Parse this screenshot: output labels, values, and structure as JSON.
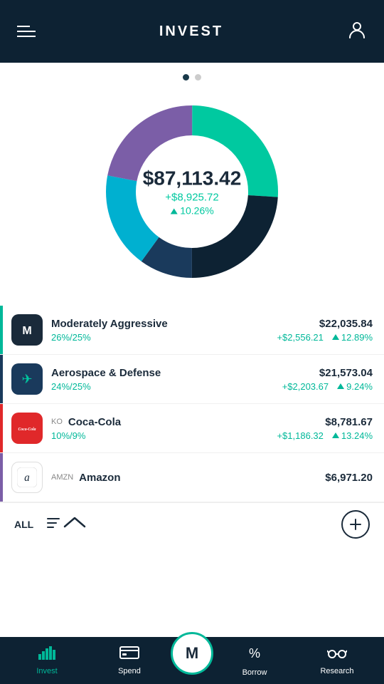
{
  "header": {
    "title": "INVEST",
    "menu_label": "menu",
    "profile_label": "profile"
  },
  "chart": {
    "value": "$87,113.42",
    "gain_dollar": "+$8,925.72",
    "gain_percent": "10.26%",
    "page_dot_active": 0,
    "segments": [
      {
        "color": "#00c9a0",
        "percent": 26,
        "label": "Teal segment"
      },
      {
        "color": "#0d2233",
        "percent": 24,
        "label": "Navy segment"
      },
      {
        "color": "#7b5ea7",
        "percent": 22,
        "label": "Purple segment"
      },
      {
        "color": "#00b0d0",
        "percent": 18,
        "label": "Light blue segment"
      },
      {
        "color": "#1a3a5c",
        "percent": 10,
        "label": "Dark navy segment"
      }
    ]
  },
  "holdings": [
    {
      "id": "moderately-aggressive",
      "name": "Moderately Aggressive",
      "ticker": "",
      "value": "$22,035.84",
      "alloc": "26%/25%",
      "change_dollar": "+$2,556.21",
      "change_pct": "12.89%",
      "color_bar": "teal",
      "icon_type": "m_dark"
    },
    {
      "id": "aerospace-defense",
      "name": "Aerospace & Defense",
      "ticker": "",
      "value": "$21,573.04",
      "alloc": "24%/25%",
      "change_dollar": "+$2,203.67",
      "change_pct": "9.24%",
      "color_bar": "navy",
      "icon_type": "plane"
    },
    {
      "id": "coca-cola",
      "name": "Coca-Cola",
      "ticker": "KO",
      "value": "$8,781.67",
      "alloc": "10%/9%",
      "change_dollar": "+$1,186.32",
      "change_pct": "13.24%",
      "color_bar": "red",
      "icon_type": "coca_cola"
    },
    {
      "id": "amazon",
      "name": "Amazon",
      "ticker": "AMZN",
      "value": "$6,971.20",
      "alloc": "",
      "change_dollar": "",
      "change_pct": "",
      "color_bar": "purple",
      "icon_type": "amazon"
    }
  ],
  "action_bar": {
    "all_label": "ALL",
    "filter_label": "filter",
    "sort_label": "sort",
    "add_label": "add"
  },
  "nav": {
    "items": [
      {
        "id": "invest",
        "label": "Invest",
        "active": true,
        "icon": "bar-chart"
      },
      {
        "id": "spend",
        "label": "Spend",
        "active": false,
        "icon": "credit-card"
      },
      {
        "id": "home",
        "label": "",
        "active": false,
        "icon": "m-logo"
      },
      {
        "id": "borrow",
        "label": "Borrow",
        "active": false,
        "icon": "percent"
      },
      {
        "id": "research",
        "label": "Research",
        "active": false,
        "icon": "glasses"
      }
    ]
  }
}
